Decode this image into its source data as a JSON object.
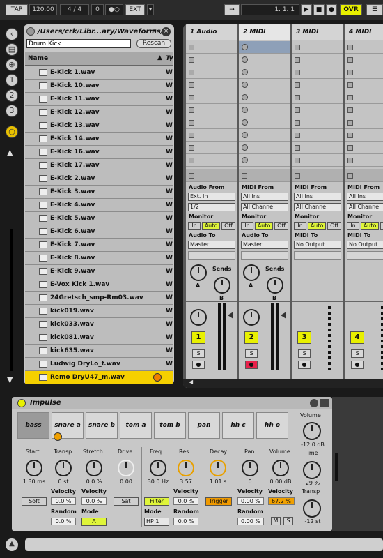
{
  "transport": {
    "tap": "TAP",
    "tempo": "120.00",
    "signature": "4 / 4",
    "metronome_count": "0",
    "ext": "EXT",
    "position": "1.   1.   1",
    "ovr": "OVR"
  },
  "browser": {
    "path": "/Users/crk/Libr...ary/Waveforms/",
    "search_value": "Drum Kick",
    "rescan": "Rescan",
    "col_name": "Name",
    "col_type": "Ty",
    "files": [
      {
        "name": "E-Kick 1.wav",
        "type": "W"
      },
      {
        "name": "E-Kick 10.wav",
        "type": "W"
      },
      {
        "name": "E-Kick 11.wav",
        "type": "W"
      },
      {
        "name": "E-Kick 12.wav",
        "type": "W"
      },
      {
        "name": "E-Kick 13.wav",
        "type": "W"
      },
      {
        "name": "E-Kick 14.wav",
        "type": "W"
      },
      {
        "name": "E-Kick 16.wav",
        "type": "W"
      },
      {
        "name": "E-Kick 17.wav",
        "type": "W"
      },
      {
        "name": "E-Kick 2.wav",
        "type": "W"
      },
      {
        "name": "E-Kick 3.wav",
        "type": "W"
      },
      {
        "name": "E-Kick 4.wav",
        "type": "W"
      },
      {
        "name": "E-Kick 5.wav",
        "type": "W"
      },
      {
        "name": "E-Kick 6.wav",
        "type": "W"
      },
      {
        "name": "E-Kick 7.wav",
        "type": "W"
      },
      {
        "name": "E-Kick 8.wav",
        "type": "W"
      },
      {
        "name": "E-Kick 9.wav",
        "type": "W"
      },
      {
        "name": "E-Vox Kick 1.wav",
        "type": "W"
      },
      {
        "name": "24Gretsch_smp-Rm03.wav",
        "type": "W"
      },
      {
        "name": "kick019.wav",
        "type": "W"
      },
      {
        "name": "kick033.wav",
        "type": "W"
      },
      {
        "name": "kick081.wav",
        "type": "W"
      },
      {
        "name": "kick635.wav",
        "type": "W"
      },
      {
        "name": "Ludwig DryLo_f.wav",
        "type": "W"
      },
      {
        "name": "Remo DryU47_m.wav",
        "type": ""
      }
    ],
    "selected_index": 23
  },
  "session": {
    "tracks": [
      {
        "name": "1 Audio",
        "io_from_label": "Audio From",
        "from": "Ext. In",
        "channel": "1/2",
        "to_label": "Audio To",
        "to": "Master",
        "num": "1",
        "color": "#e8f000"
      },
      {
        "name": "2 MIDI",
        "io_from_label": "MIDI From",
        "from": "All Ins",
        "channel": "All Channe",
        "to_label": "Audio To",
        "to": "Master",
        "num": "2",
        "color": "#e8f000"
      },
      {
        "name": "3 MIDI",
        "io_from_label": "MIDI From",
        "from": "All Ins",
        "channel": "All Channe",
        "to_label": "MIDI To",
        "to": "No Output",
        "num": "3",
        "color": "#e8f000"
      },
      {
        "name": "4 MIDI",
        "io_from_label": "MIDI From",
        "from": "All Ins",
        "channel": "All Channe",
        "to_label": "MIDI To",
        "to": "No Output",
        "num": "4",
        "color": "#e8f000"
      }
    ],
    "monitor_label": "Monitor",
    "monitor_in": "In",
    "monitor_auto": "Auto",
    "monitor_off": "Off",
    "sends_label": "Sends",
    "send_a": "A",
    "send_b": "B",
    "solo": "S"
  },
  "device": {
    "title": "Impulse",
    "pads": [
      "bass",
      "snare a",
      "snare b",
      "tom a",
      "tom b",
      "pan",
      "hh c",
      "hh o"
    ],
    "volume_label": "Volume",
    "volume_value": "-12.0 dB",
    "time_label": "Time",
    "time_value": "29 %",
    "transp_label": "Transp",
    "transp_value": "-12 st",
    "start_label": "Start",
    "start_value": "1.30 ms",
    "transp2_label": "Transp",
    "transp2_value": "0 st",
    "stretch_label": "Stretch",
    "stretch_value": "0.0 %",
    "drive_label": "Drive",
    "drive_value": "0.00",
    "freq_label": "Freq",
    "freq_value": "30.0 Hz",
    "res_label": "Res",
    "res_value": "3.57",
    "decay_label": "Decay",
    "decay_value": "1.01 s",
    "pan_label": "Pan",
    "pan_value": "0",
    "vol2_label": "Volume",
    "vol2_value": "0.00 dB",
    "soft": "Soft",
    "sat": "Sat",
    "filter": "Filter",
    "trigger": "Trigger",
    "velocity_label": "Velocity",
    "random_label": "Random",
    "mode_label": "Mode",
    "vel_transp": "0.0 %",
    "rnd_transp": "0.0 %",
    "vel_stretch": "0.0 %",
    "mode_stretch": "A",
    "vel_res": "0.0 %",
    "mode_filter": "HP 1",
    "rnd_res": "0.0 %",
    "vel_pan": "0.00 %",
    "rnd_pan": "0.00 %",
    "vel_vol": "67.2 %",
    "m_btn": "M",
    "s_btn": "S"
  }
}
